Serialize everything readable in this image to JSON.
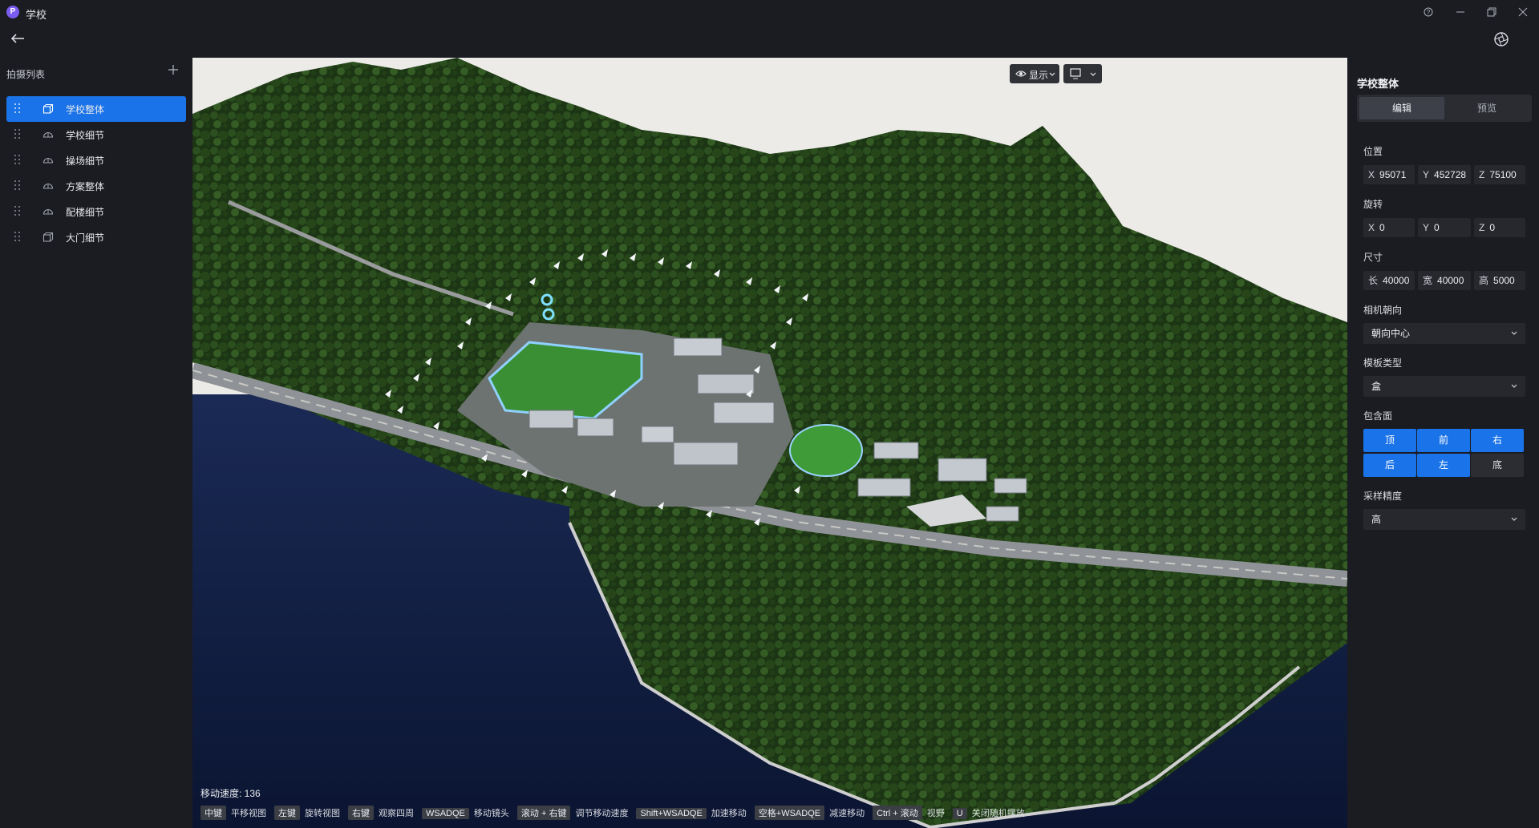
{
  "window": {
    "logo_letter": "P",
    "title": "学校",
    "controls": [
      "help-icon",
      "minimize-icon",
      "restore-icon",
      "close-icon"
    ]
  },
  "left_panel": {
    "header": "拍摄列表",
    "items": [
      {
        "label": "学校整体",
        "icon": "cube-icon",
        "active": true
      },
      {
        "label": "学校细节",
        "icon": "dome-icon",
        "active": false
      },
      {
        "label": "操场细节",
        "icon": "dome-icon",
        "active": false
      },
      {
        "label": "方案整体",
        "icon": "dome-icon",
        "active": false
      },
      {
        "label": "配楼细节",
        "icon": "dome-icon",
        "active": false
      },
      {
        "label": "大门细节",
        "icon": "cube-icon",
        "active": false
      }
    ]
  },
  "viewport": {
    "display_button": "显示",
    "speed_text": "移动速度: 136",
    "hints": [
      {
        "key": "中键",
        "desc": "平移视图"
      },
      {
        "key": "左键",
        "desc": "旋转视图"
      },
      {
        "key": "右键",
        "desc": "观察四周"
      },
      {
        "key": "WSADQE",
        "desc": "移动镜头"
      },
      {
        "key": "滚动 + 右键",
        "desc": "调节移动速度"
      },
      {
        "key": "Shift+WSADQE",
        "desc": "加速移动"
      },
      {
        "key": "空格+WSADQE",
        "desc": "减速移动"
      },
      {
        "key": "Ctrl + 滚动",
        "desc": "视野"
      },
      {
        "key": "U",
        "desc": "关闭随机摆放"
      }
    ]
  },
  "right_panel": {
    "title": "学校整体",
    "tabs": [
      {
        "label": "编辑",
        "active": true
      },
      {
        "label": "预览",
        "active": false
      }
    ],
    "position": {
      "label": "位置",
      "x_label": "X",
      "x": "95071",
      "y_label": "Y",
      "y": "452728",
      "z_label": "Z",
      "z": "75100"
    },
    "rotation": {
      "label": "旋转",
      "x_label": "X",
      "x": "0",
      "y_label": "Y",
      "y": "0",
      "z_label": "Z",
      "z": "0"
    },
    "size": {
      "label": "尺寸",
      "l_label": "长",
      "l": "40000",
      "w_label": "宽",
      "w": "40000",
      "h_label": "高",
      "h": "5000"
    },
    "camera_direction": {
      "label": "相机朝向",
      "value": "朝向中心"
    },
    "template_type": {
      "label": "模板类型",
      "value": "盒"
    },
    "faces": {
      "label": "包含面",
      "items": [
        {
          "label": "顶",
          "on": true
        },
        {
          "label": "前",
          "on": true
        },
        {
          "label": "右",
          "on": true
        },
        {
          "label": "后",
          "on": true
        },
        {
          "label": "左",
          "on": true
        },
        {
          "label": "底",
          "on": false
        }
      ]
    },
    "sampling": {
      "label": "采样精度",
      "value": "高"
    }
  },
  "colors": {
    "accent": "#1a73e8",
    "panel_bg": "#1b1c21",
    "field_bg": "#26282d",
    "water": "#0e1c40",
    "forest": "#1f3a17"
  }
}
